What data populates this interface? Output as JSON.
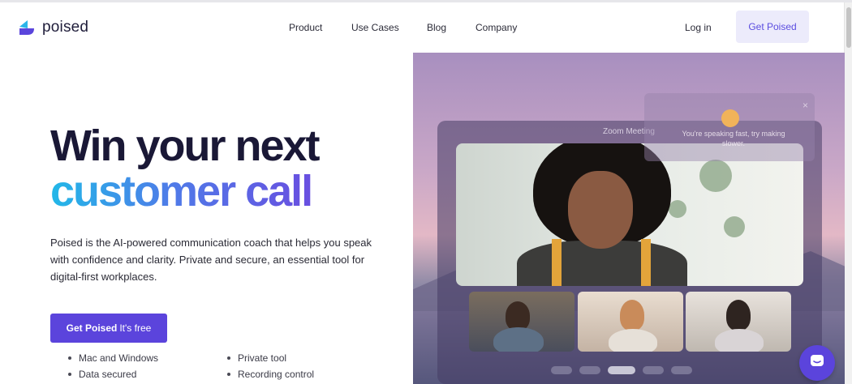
{
  "brand": {
    "name": "poised"
  },
  "nav": {
    "items": [
      "Product",
      "Use Cases",
      "Blog",
      "Company"
    ],
    "login": "Log in",
    "cta": "Get Poised"
  },
  "hero": {
    "title_line1": "Win your next",
    "title_line2": "customer call",
    "description": "Poised is the AI-powered communication coach that helps you speak with confidence and clarity. Private and secure, an essential tool for digital-first workplaces.",
    "cta_bold": "Get Poised",
    "cta_rest": "It's free",
    "features_left": [
      "Mac and Windows",
      "Data secured"
    ],
    "features_right": [
      "Private tool",
      "Recording control"
    ]
  },
  "preview": {
    "window_title": "Zoom Meeting",
    "notice_text": "You're speaking fast, try making slower.",
    "notice_close": "×"
  },
  "colors": {
    "accent": "#5b44dc",
    "accent_light": "#ecebfb",
    "title_dark": "#1a1836",
    "gradient_start": "#22b8e8",
    "gradient_end": "#6a4de0"
  }
}
